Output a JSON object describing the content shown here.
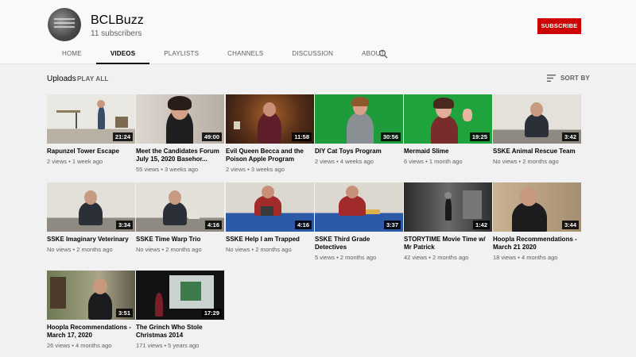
{
  "channel": {
    "name": "BCLBuzz",
    "subscribers": "11 subscribers",
    "subscribe_label": "SUBSCRIBE"
  },
  "tabs": [
    "HOME",
    "VIDEOS",
    "PLAYLISTS",
    "CHANNELS",
    "DISCUSSION",
    "ABOUT"
  ],
  "active_tab": "VIDEOS",
  "uploads": {
    "title": "Uploads",
    "play_all": "PLAY ALL",
    "sort_label": "SORT BY"
  },
  "videos": [
    {
      "title": "Rapunzel Tower Escape",
      "views": "2 views",
      "age": "1 week ago",
      "duration": "21:24"
    },
    {
      "title": "Meet the Candidates Forum July 15, 2020 Basehor...",
      "views": "55 views",
      "age": "3 weeks ago",
      "duration": "49:00"
    },
    {
      "title": "Evil Queen Becca and the Poison Apple Program",
      "views": "2 views",
      "age": "3 weeks ago",
      "duration": "11:58"
    },
    {
      "title": "DIY Cat Toys Program",
      "views": "2 views",
      "age": "4 weeks ago",
      "duration": "30:56"
    },
    {
      "title": "Mermaid Slime",
      "views": "6 views",
      "age": "1 month ago",
      "duration": "19:25"
    },
    {
      "title": "SSKE Animal Rescue Team",
      "views": "No views",
      "age": "2 months ago",
      "duration": "3:42"
    },
    {
      "title": "SSKE Imaginary Veterinary",
      "views": "No views",
      "age": "2 months ago",
      "duration": "3:34"
    },
    {
      "title": "SSKE Time Warp Trio",
      "views": "No views",
      "age": "2 months ago",
      "duration": "4:16"
    },
    {
      "title": "SSKE Help I am Trapped",
      "views": "No views",
      "age": "2 months ago",
      "duration": "4:16"
    },
    {
      "title": "SSKE Third Grade Detectives",
      "views": "5 views",
      "age": "2 months ago",
      "duration": "3:37"
    },
    {
      "title": "STORYTIME Movie Time w/ Mr Patrick",
      "views": "42 views",
      "age": "2 months ago",
      "duration": "1:42"
    },
    {
      "title": "Hoopla Recommendations - March 21 2020",
      "views": "18 views",
      "age": "4 months ago",
      "duration": "3:44"
    },
    {
      "title": "Hoopla Recommendations - March 17, 2020",
      "views": "26 views",
      "age": "4 months ago",
      "duration": "3:51"
    },
    {
      "title": "The Grinch Who Stole Christmas 2014",
      "views": "171 views",
      "age": "5 years ago",
      "duration": "17:29"
    }
  ],
  "colors": {
    "subscribe_bg": "#cc0000",
    "page_bg": "#f1f1f1",
    "header_bg": "#f9f9f9"
  }
}
